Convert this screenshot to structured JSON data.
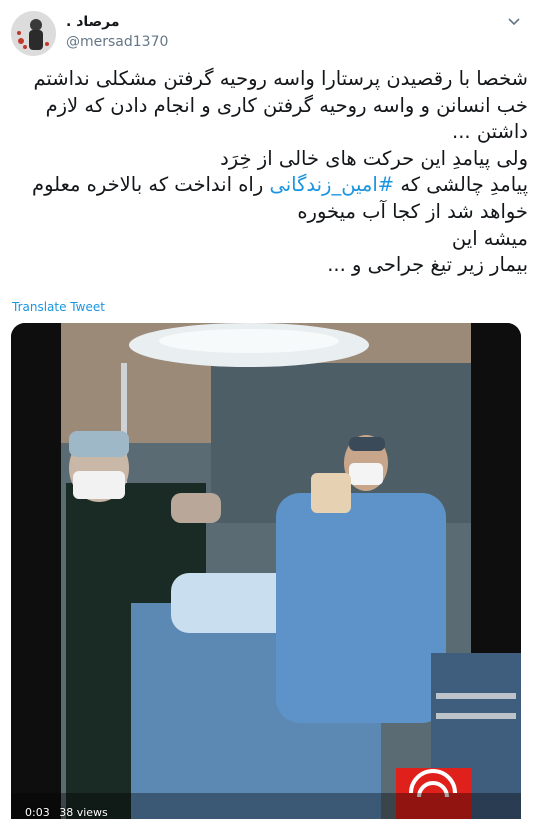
{
  "author": {
    "display_name": "مرصاد .",
    "handle": "@mersad1370"
  },
  "tweet": {
    "line1": "شخصا با رقصیدن پرستارا واسه روحیه گرفتن مشکلی نداشتم",
    "line2": "خب انسانن و واسه روحیه گرفتن کاری و انجام دادن که لازم",
    "line3": "داشتن ...",
    "line4": "ولی پیامدِ این حرکت های خالی از خِرَد",
    "line5_before": "پیامدِ چالشی که ",
    "hashtag": "#امین_زندگانی",
    "line5_after": " راه انداخت که بالاخره معلوم",
    "line6": "خواهد شد از کجا آب میخوره",
    "line7": "میشه این",
    "line8": "بیمار زیر تیغ جراحی و ..."
  },
  "translate_label": "Translate Tweet",
  "video": {
    "time": "0:03",
    "views": "38 views"
  },
  "icons": {
    "caret": "chevron-down-icon",
    "avatar": "avatar-image",
    "broadcaster_logo": "channel-logo-icon"
  },
  "colors": {
    "link": "#1b95e0",
    "secondary_text": "#657786",
    "logo_red": "#e0201b"
  }
}
